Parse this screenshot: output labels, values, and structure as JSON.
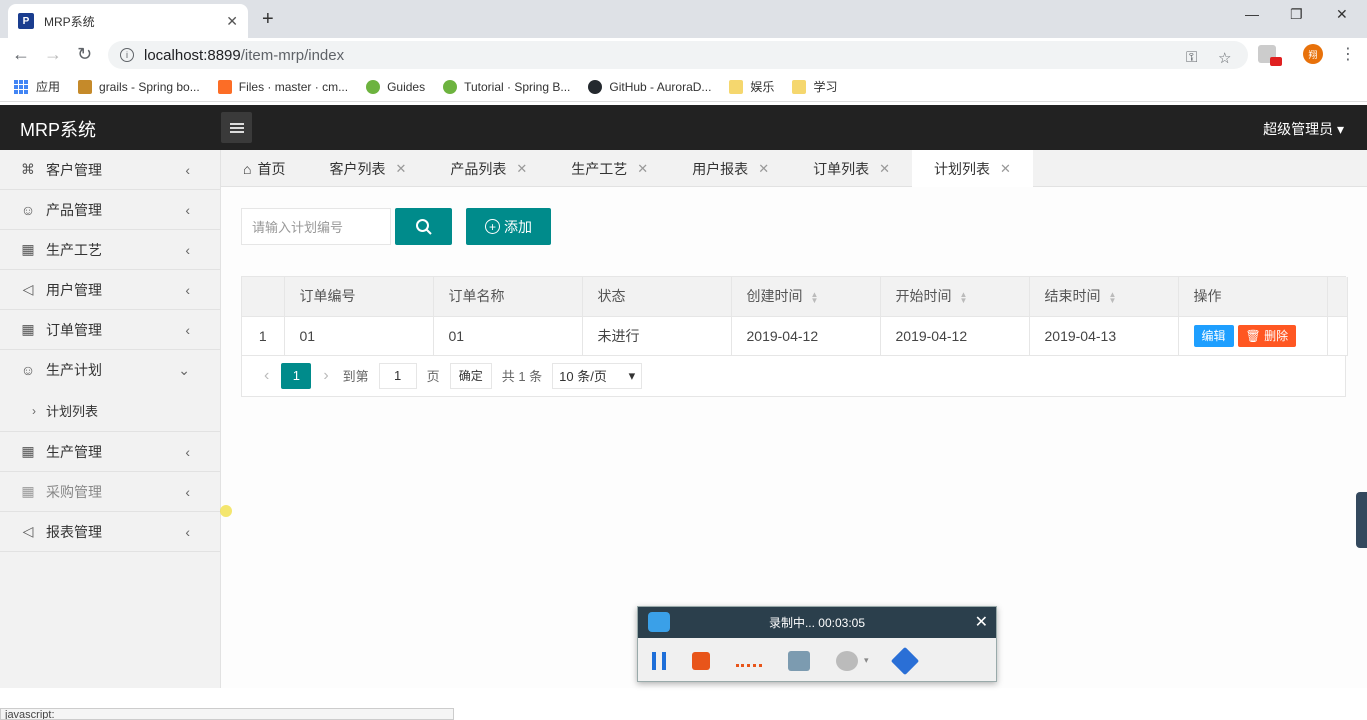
{
  "browser": {
    "tab_title": "MRP系统",
    "favicon_text": "P",
    "url_host": "localhost:8899",
    "url_path": "/item-mrp/index",
    "profile_initial": "翔",
    "bookmarks": [
      {
        "label": "应用",
        "icon": "apps-grid-icon",
        "color": "#4285f4"
      },
      {
        "label": "grails - Spring bo...",
        "icon": "grails-icon",
        "color": "#c58a2a"
      },
      {
        "label": "Files · master · cm...",
        "icon": "gitlab-icon",
        "color": "#fc6d26"
      },
      {
        "label": "Guides",
        "icon": "spring-icon",
        "color": "#6db33f"
      },
      {
        "label": "Tutorial · Spring B...",
        "icon": "spring-icon",
        "color": "#6db33f"
      },
      {
        "label": "GitHub - AuroraD...",
        "icon": "github-icon",
        "color": "#24292e"
      },
      {
        "label": "娱乐",
        "icon": "folder-icon",
        "color": "#f5d76e"
      },
      {
        "label": "学习",
        "icon": "folder-icon",
        "color": "#f5d76e"
      }
    ]
  },
  "header": {
    "brand": "MRP系统",
    "user": "超级管理员"
  },
  "sidebar": {
    "items": [
      {
        "label": "客户管理",
        "icon": "clover-icon",
        "glyph": "⌘",
        "expanded": false
      },
      {
        "label": "产品管理",
        "icon": "user-icon",
        "glyph": "☺",
        "expanded": false
      },
      {
        "label": "生产工艺",
        "icon": "calendar-icon",
        "glyph": "▦",
        "expanded": false
      },
      {
        "label": "用户管理",
        "icon": "speaker-icon",
        "glyph": "◁",
        "expanded": false
      },
      {
        "label": "订单管理",
        "icon": "calendar-icon",
        "glyph": "▦",
        "expanded": false
      },
      {
        "label": "生产计划",
        "icon": "user-icon",
        "glyph": "☺",
        "expanded": true
      },
      {
        "label": "生产管理",
        "icon": "calendar-icon",
        "glyph": "▦",
        "expanded": false
      },
      {
        "label": "采购管理",
        "icon": "calendar-icon",
        "glyph": "▦",
        "expanded": false
      },
      {
        "label": "报表管理",
        "icon": "speaker-icon",
        "glyph": "◁",
        "expanded": false
      }
    ],
    "submenu": "计划列表"
  },
  "tabs": [
    {
      "label": "首页",
      "closable": false
    },
    {
      "label": "客户列表",
      "closable": true
    },
    {
      "label": "产品列表",
      "closable": true
    },
    {
      "label": "生产工艺",
      "closable": true
    },
    {
      "label": "用户报表",
      "closable": true
    },
    {
      "label": "订单列表",
      "closable": true
    },
    {
      "label": "计划列表",
      "closable": true,
      "active": true
    }
  ],
  "toolbar": {
    "search_placeholder": "请输入计划编号",
    "add_label": "添加"
  },
  "table": {
    "columns": [
      "订单编号",
      "订单名称",
      "状态",
      "创建时间",
      "开始时间",
      "结束时间",
      "操作"
    ],
    "sortable": [
      false,
      false,
      false,
      true,
      true,
      true,
      false
    ],
    "rows": [
      {
        "index": "1",
        "order_no": "01",
        "order_name": "01",
        "status": "未进行",
        "created": "2019-04-12",
        "start": "2019-04-12",
        "end": "2019-04-13"
      }
    ],
    "edit_label": "编辑",
    "delete_label": "删除"
  },
  "pager": {
    "current": "1",
    "goto_label": "到第",
    "goto_value": "1",
    "page_label": "页",
    "confirm_label": "确定",
    "total_label": "共 1 条",
    "size_label": "10 条/页"
  },
  "recorder": {
    "status": "录制中... 00:03:05"
  },
  "statusbar": "javascript:"
}
